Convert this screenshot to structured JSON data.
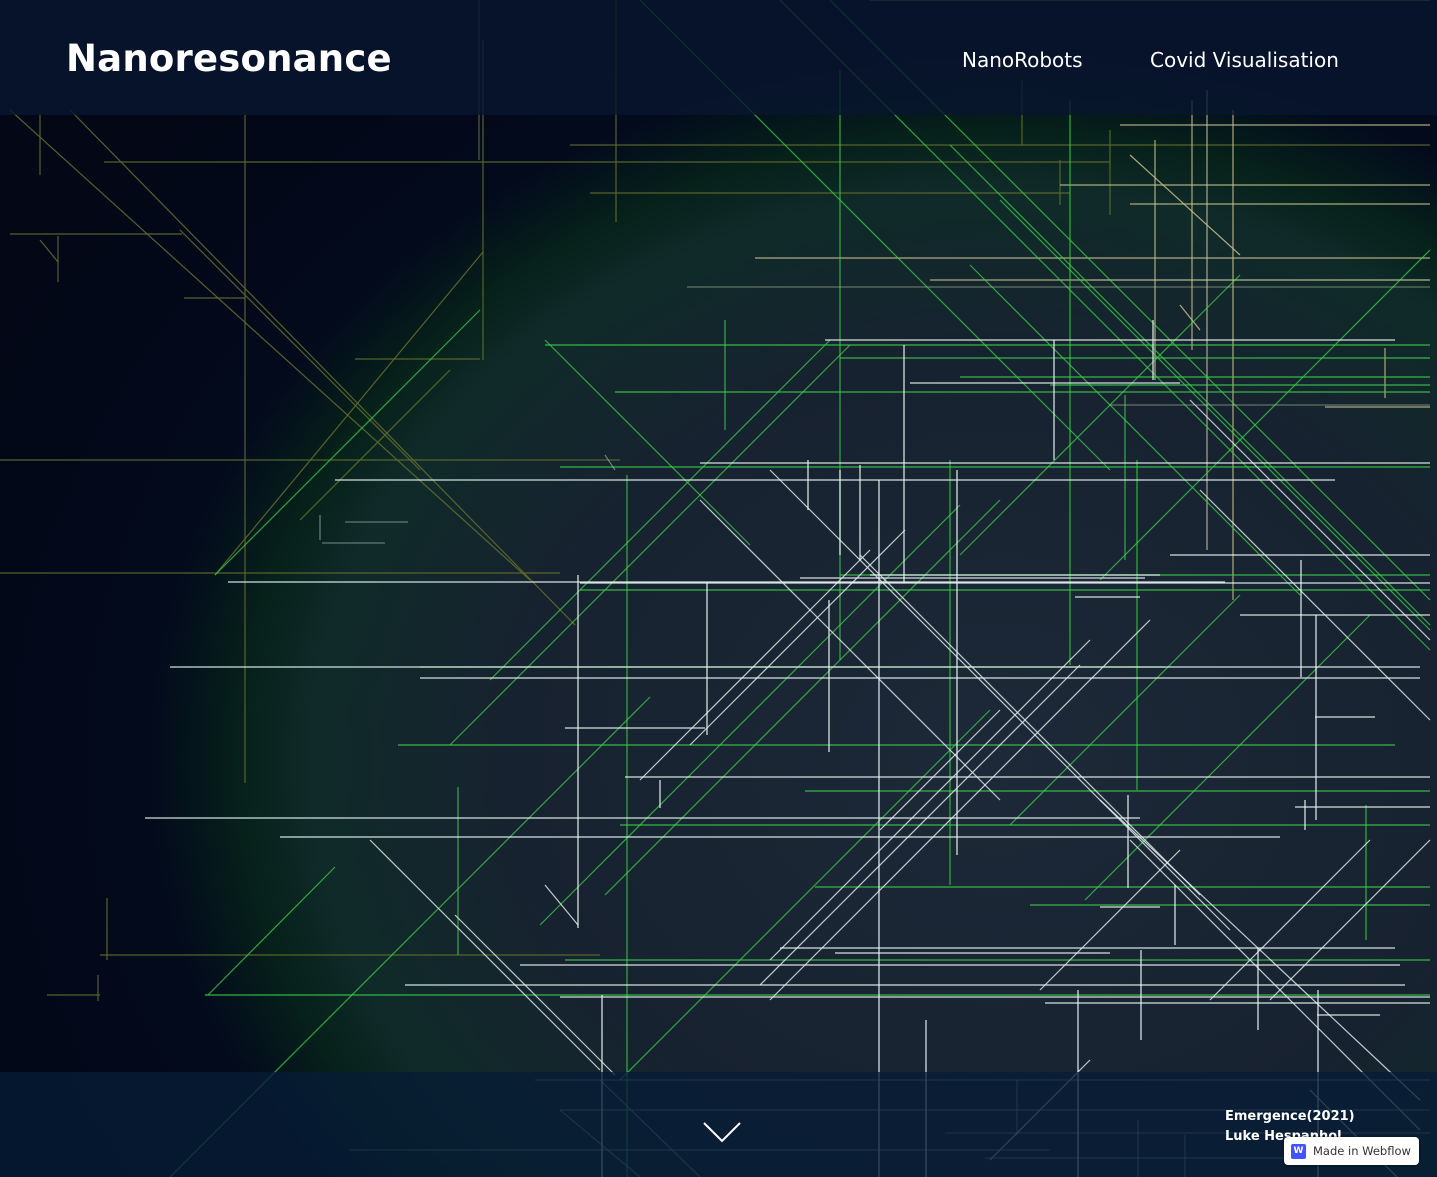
{
  "site": {
    "brand": "Nanoresonance"
  },
  "nav": {
    "items": [
      {
        "label": "NanoRobots"
      },
      {
        "label": "Covid Visualisation"
      }
    ]
  },
  "credit": {
    "title": "Emergence(2021)",
    "author": "Luke Hespanhol"
  },
  "badge": {
    "logo": "W",
    "label": "Made in Webflow"
  },
  "icons": {
    "scroll": "chevron-down-icon",
    "badge": "webflow-logo-icon"
  },
  "colors": {
    "background": "#030716",
    "bar": "#0b1a36",
    "olive_lines": "#5f6b2e",
    "green_lines": "#3cd04a",
    "white_lines": "#e9f5f2",
    "webflow_blue": "#4353ff"
  }
}
